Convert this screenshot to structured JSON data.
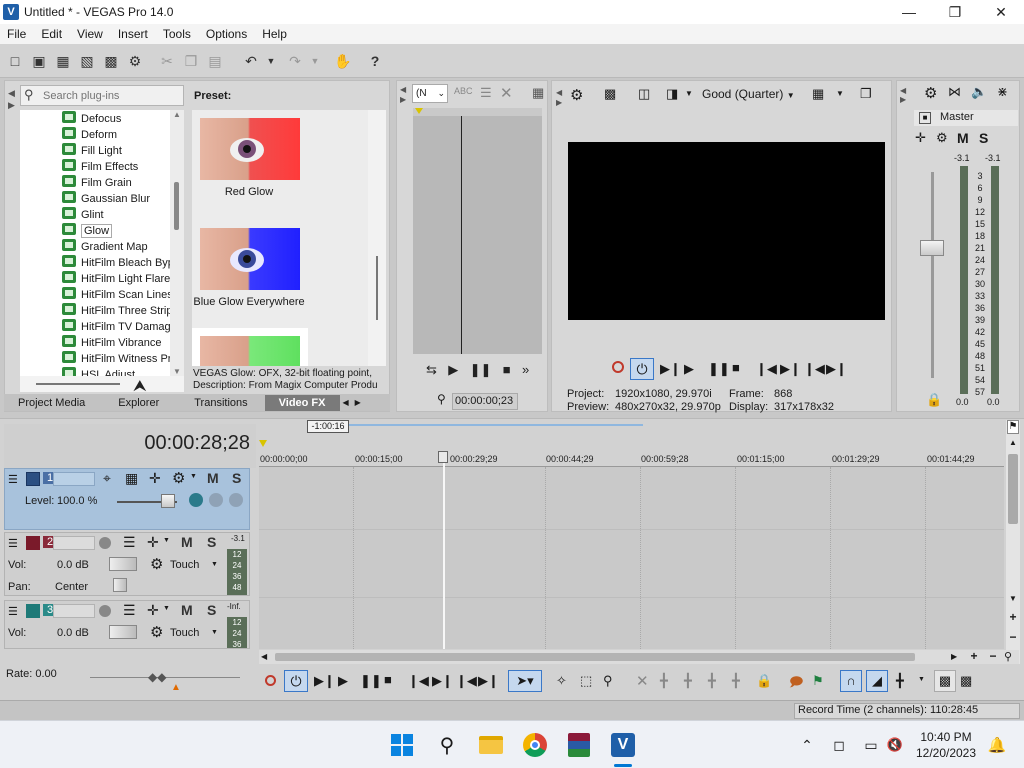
{
  "window": {
    "title": "Untitled * - VEGAS Pro 14.0"
  },
  "menu": [
    "File",
    "Edit",
    "View",
    "Insert",
    "Tools",
    "Options",
    "Help"
  ],
  "plugins": {
    "search_placeholder": "Search plug-ins",
    "items": [
      "Defocus",
      "Deform",
      "Fill Light",
      "Film Effects",
      "Film Grain",
      "Gaussian Blur",
      "Glint",
      "Glow",
      "Gradient Map",
      "HitFilm Bleach Byp",
      "HitFilm Light Flares",
      "HitFilm Scan Lines",
      "HitFilm Three Strip",
      "HitFilm TV Damage",
      "HitFilm Vibrance",
      "HitFilm Witness Pr",
      "HSL Adjust"
    ],
    "selected": "Glow"
  },
  "presets": {
    "label": "Preset:",
    "items": [
      "Red Glow",
      "Blue Glow Everywhere"
    ],
    "info_line1": "VEGAS Glow: OFX, 32-bit floating point,",
    "info_line2": "Description: From Magix Computer Produ"
  },
  "tabs": [
    "Project Media",
    "Explorer",
    "Transitions",
    "Video FX"
  ],
  "trimmer": {
    "combo": "(N",
    "timecode": "00:00:00;23"
  },
  "preview": {
    "quality": "Good (Quarter)",
    "project_label": "Project:",
    "project_value": "1920x1080, 29.970i",
    "frame_label": "Frame:",
    "frame_value": "868",
    "preview_label": "Preview:",
    "preview_value": "480x270x32, 29.970p",
    "display_label": "Display:",
    "display_value": "317x178x32"
  },
  "master": {
    "label": "Master",
    "peak_l": "-3.1",
    "peak_r": "-3.1",
    "scale": [
      "3",
      "6",
      "9",
      "12",
      "15",
      "18",
      "21",
      "24",
      "27",
      "30",
      "33",
      "36",
      "39",
      "42",
      "45",
      "48",
      "51",
      "54",
      "57"
    ],
    "val_l": "0.0",
    "val_r": "0.0"
  },
  "timeline": {
    "timecode": "00:00:28;28",
    "marker": "-1:00:16",
    "ruler": [
      "00:00:00;00",
      "00:00:15;00",
      "00:00:29;29",
      "00:00:44;29",
      "00:00:59;28",
      "00:01:15;00",
      "00:01:29;29",
      "00:01:44;29"
    ]
  },
  "tracks": [
    {
      "num": "1",
      "kind": "video",
      "level_label": "Level:",
      "level_value": "100.0 %"
    },
    {
      "num": "2",
      "kind": "audio",
      "vol_label": "Vol:",
      "vol_value": "0.0 dB",
      "pan_label": "Pan:",
      "pan_value": "Center",
      "mode": "Touch",
      "meter_top": "-3.1",
      "meter_scale": [
        "12",
        "24",
        "36",
        "48"
      ]
    },
    {
      "num": "3",
      "kind": "audio",
      "vol_label": "Vol:",
      "vol_value": "0.0 dB",
      "mode": "Touch",
      "meter_top": "-Inf.",
      "meter_scale": [
        "12",
        "24",
        "36"
      ]
    }
  ],
  "rate": "Rate: 0.00",
  "status": "Record Time (2 channels): 110:28:45",
  "taskbar": {
    "time": "10:40 PM",
    "date": "12/20/2023"
  },
  "colors": {
    "accent": "#0078d4",
    "track_video": "#a8c2dc",
    "record": "#c0392b"
  }
}
